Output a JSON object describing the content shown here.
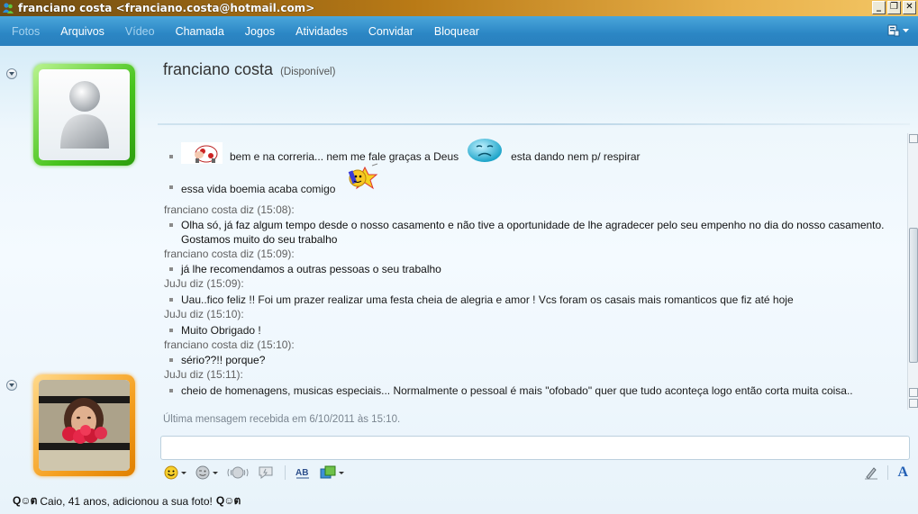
{
  "window": {
    "title": "franciano costa <franciano.costa@hotmail.com>",
    "buttons": {
      "minimize": "_",
      "restore": "❐",
      "close": "✕"
    }
  },
  "menu": {
    "items": [
      {
        "label": "Fotos",
        "enabled": false
      },
      {
        "label": "Arquivos",
        "enabled": true
      },
      {
        "label": "Vídeo",
        "enabled": false
      },
      {
        "label": "Chamada",
        "enabled": true
      },
      {
        "label": "Jogos",
        "enabled": true
      },
      {
        "label": "Atividades",
        "enabled": true
      },
      {
        "label": "Convidar",
        "enabled": true
      },
      {
        "label": "Bloquear",
        "enabled": true
      }
    ]
  },
  "contact": {
    "name": "franciano costa",
    "status": "(Disponível)"
  },
  "conversation": {
    "messages": [
      {
        "type": "msg",
        "parts": [
          "",
          "bem e na correria... nem me fale graças a Deus",
          "esta dando nem p/ respirar"
        ]
      },
      {
        "type": "msg",
        "text": "essa vida boemia acaba comigo"
      },
      {
        "type": "sender",
        "text": "franciano costa diz (15:08):"
      },
      {
        "type": "msg",
        "text": "Olha só, já faz algum tempo desde o nosso casamento e não tive a oportunidade de lhe agradecer pelo seu empenho no dia do nosso casamento. Gostamos muito do seu trabalho"
      },
      {
        "type": "sender",
        "text": "franciano costa diz (15:09):"
      },
      {
        "type": "msg",
        "text": "já lhe recomendamos a outras pessoas o seu trabalho"
      },
      {
        "type": "sender",
        "text": "JuJu diz (15:09):"
      },
      {
        "type": "msg",
        "text": "Uau..fico feliz !! Foi um prazer realizar uma festa cheia de alegria e amor ! Vcs foram os casais mais romanticos que fiz até hoje"
      },
      {
        "type": "sender",
        "text": "JuJu diz (15:10):"
      },
      {
        "type": "msg",
        "text": "Muito Obrigado !"
      },
      {
        "type": "sender",
        "text": "franciano costa diz (15:10):"
      },
      {
        "type": "msg",
        "text": "sério??!! porque?"
      },
      {
        "type": "sender",
        "text": "JuJu diz (15:11):"
      },
      {
        "type": "msg",
        "text": "cheio de homenagens, musicas especiais... Normalmente o pessoal é mais \"ofobado\" quer que tudo aconteça logo então corta muita coisa.."
      }
    ]
  },
  "last_message": "Última mensagem recebida em 6/10/2011 às 15:10.",
  "input": {
    "value": "",
    "placeholder": ""
  },
  "toolbar": {
    "icons": [
      "emoticon-icon",
      "wink-icon",
      "nudge-icon",
      "voice-clip-icon",
      "spell-check-icon",
      "background-icon",
      "handwriting-icon",
      "font-icon"
    ],
    "font_label": "A"
  },
  "statusbar": {
    "prefix": "Q☺ต",
    "text": "Caio, 41 anos, adicionou a sua foto!",
    "suffix": "Q☺ต"
  },
  "colors": {
    "menu_bar": "#2b86c4",
    "titlebar": "#b97a16",
    "contact_frame": "#48c41d",
    "self_frame": "#f5a020"
  }
}
